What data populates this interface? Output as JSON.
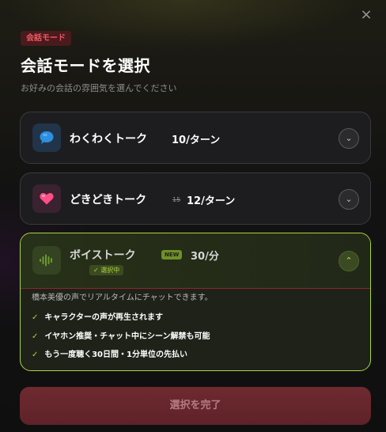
{
  "close_icon": "×",
  "mode_tag": "会話モード",
  "title": "会話モードを選択",
  "subtitle": "お好みの会話の雰囲気を選んでください",
  "options": [
    {
      "name": "わくわくトーク",
      "rate": "10/ターン",
      "icon": "speech-bubble-icon",
      "icon_color": "#2e8fe0"
    },
    {
      "name": "どきどきトーク",
      "old_rate": "15",
      "rate": "12/ターン",
      "icon": "heart-icon",
      "icon_color": "#ff4f86"
    },
    {
      "name": "ボイストーク",
      "badge": "NEW",
      "rate": "30/分",
      "selected_label": "✓ 選択中",
      "icon": "sound-wave-icon",
      "icon_color": "#6c9a2e",
      "description": "橋本美優の声でリアルタイムにチャットできます。",
      "features": [
        "キャラクターの声が再生されます",
        "イヤホン推奨・チャット中にシーン解禁も可能",
        "もう一度聴く30日間・1分単位の先払い"
      ]
    }
  ],
  "chevron_down": "⌄",
  "chevron_up": "⌃",
  "check": "✓",
  "confirm_button": "選択を完了",
  "colors": {
    "accent_green": "#a9d63d",
    "tag_red": "#ef5a63",
    "button_red": "#6e2a30"
  }
}
